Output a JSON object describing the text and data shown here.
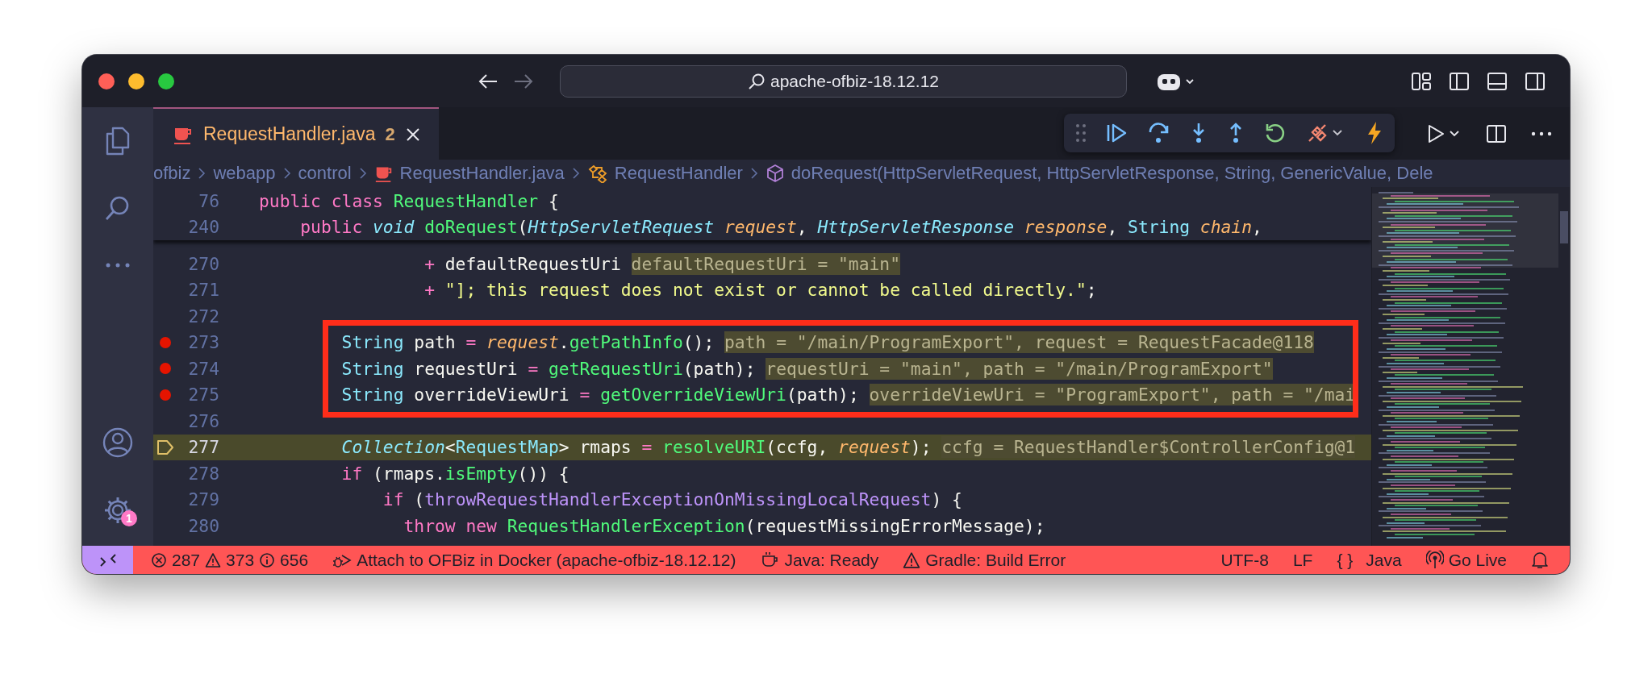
{
  "window": {
    "title": "apache-ofbiz-18.12.12"
  },
  "activity_bar": {
    "settings_badge": "1"
  },
  "tabs": [
    {
      "label": "RequestHandler.java",
      "problems": "2",
      "selected": true
    }
  ],
  "breadcrumbs": [
    {
      "kind": "folder",
      "label": "ofbiz"
    },
    {
      "kind": "folder",
      "label": "webapp"
    },
    {
      "kind": "folder",
      "label": "control"
    },
    {
      "kind": "file",
      "label": "RequestHandler.java"
    },
    {
      "kind": "class",
      "label": "RequestHandler"
    },
    {
      "kind": "method",
      "label": "doRequest(HttpServletRequest, HttpServletResponse, String, GenericValue, Dele"
    }
  ],
  "sticky_lines": [
    {
      "number": "76",
      "tokens": [
        {
          "kind": "kw",
          "text": "public class "
        },
        {
          "kind": "fn",
          "text": "RequestHandler"
        },
        {
          "kind": "plain",
          "text": " {"
        }
      ]
    },
    {
      "number": "240",
      "tokens": [
        {
          "kind": "kw",
          "text": "    public "
        },
        {
          "kind": "typei",
          "text": "void "
        },
        {
          "kind": "fn",
          "text": "doRequest"
        },
        {
          "kind": "plain",
          "text": "("
        },
        {
          "kind": "typei",
          "text": "HttpServletRequest"
        },
        {
          "kind": "param",
          "text": " request"
        },
        {
          "kind": "plain",
          "text": ", "
        },
        {
          "kind": "typei",
          "text": "HttpServletResponse"
        },
        {
          "kind": "param",
          "text": " response"
        },
        {
          "kind": "plain",
          "text": ", "
        },
        {
          "kind": "type",
          "text": "String"
        },
        {
          "kind": "param",
          "text": " chain"
        },
        {
          "kind": "plain",
          "text": ","
        }
      ]
    }
  ],
  "lines": [
    {
      "number": "270",
      "breakpoint": false,
      "current": false,
      "boxed": false,
      "tokens": [
        {
          "kind": "op",
          "text": "                + "
        },
        {
          "kind": "plain",
          "text": "defaultRequestUri "
        },
        {
          "kind": "hint",
          "text": "defaultRequestUri = \"main\""
        }
      ]
    },
    {
      "number": "271",
      "breakpoint": false,
      "current": false,
      "boxed": false,
      "tokens": [
        {
          "kind": "op",
          "text": "                + "
        },
        {
          "kind": "str",
          "text": "\"]; this request does not exist or cannot be called directly.\""
        },
        {
          "kind": "plain",
          "text": ";"
        }
      ]
    },
    {
      "number": "272",
      "breakpoint": false,
      "current": false,
      "boxed": false
    },
    {
      "number": "273",
      "breakpoint": true,
      "current": false,
      "boxed": true,
      "tokens": [
        {
          "kind": "type",
          "text": "        String"
        },
        {
          "kind": "plain",
          "text": " path "
        },
        {
          "kind": "op",
          "text": "="
        },
        {
          "kind": "param",
          "text": " request"
        },
        {
          "kind": "plain",
          "text": "."
        },
        {
          "kind": "fn",
          "text": "getPathInfo"
        },
        {
          "kind": "plain",
          "text": "(); "
        },
        {
          "kind": "hint",
          "text": "path = \"/main/ProgramExport\", request = RequestFacade@118"
        }
      ]
    },
    {
      "number": "274",
      "breakpoint": true,
      "current": false,
      "boxed": true,
      "tokens": [
        {
          "kind": "type",
          "text": "        String"
        },
        {
          "kind": "plain",
          "text": " requestUri "
        },
        {
          "kind": "op",
          "text": "="
        },
        {
          "kind": "fn",
          "text": " getRequestUri"
        },
        {
          "kind": "plain",
          "text": "(path); "
        },
        {
          "kind": "hint",
          "text": "requestUri = \"main\", path = \"/main/ProgramExport\""
        }
      ]
    },
    {
      "number": "275",
      "breakpoint": true,
      "current": false,
      "boxed": true,
      "tokens": [
        {
          "kind": "type",
          "text": "        String"
        },
        {
          "kind": "plain",
          "text": " overrideViewUri "
        },
        {
          "kind": "op",
          "text": "="
        },
        {
          "kind": "fn",
          "text": " getOverrideViewUri"
        },
        {
          "kind": "plain",
          "text": "(path); "
        },
        {
          "kind": "hint",
          "text": "overrideViewUri = \"ProgramExport\", path = \"/mai"
        }
      ]
    },
    {
      "number": "276",
      "breakpoint": false,
      "current": false,
      "boxed": false
    },
    {
      "number": "277",
      "breakpoint": false,
      "current": true,
      "boxed": false,
      "tokens": [
        {
          "kind": "typei",
          "text": "        Collection"
        },
        {
          "kind": "plain",
          "text": "<"
        },
        {
          "kind": "type",
          "text": "RequestMap"
        },
        {
          "kind": "plain",
          "text": "> rmaps "
        },
        {
          "kind": "op",
          "text": "="
        },
        {
          "kind": "fn",
          "text": " resolveURI"
        },
        {
          "kind": "plain",
          "text": "(ccfg, "
        },
        {
          "kind": "param",
          "text": "request"
        },
        {
          "kind": "plain",
          "text": "); "
        },
        {
          "kind": "hint",
          "text": "ccfg = RequestHandler$ControllerConfig@1"
        }
      ]
    },
    {
      "number": "278",
      "breakpoint": false,
      "current": false,
      "boxed": false,
      "tokens": [
        {
          "kind": "kw",
          "text": "        if"
        },
        {
          "kind": "plain",
          "text": " (rmaps."
        },
        {
          "kind": "fn",
          "text": "isEmpty"
        },
        {
          "kind": "plain",
          "text": "()) {"
        }
      ]
    },
    {
      "number": "279",
      "breakpoint": false,
      "current": false,
      "boxed": false,
      "tokens": [
        {
          "kind": "kw",
          "text": "            if"
        },
        {
          "kind": "plain",
          "text": " ("
        },
        {
          "kind": "field",
          "text": "throwRequestHandlerExceptionOnMissingLocalRequest"
        },
        {
          "kind": "plain",
          "text": ") {"
        }
      ]
    },
    {
      "number": "280",
      "breakpoint": false,
      "current": false,
      "boxed": false,
      "tokens": [
        {
          "kind": "kw",
          "text": "              throw new"
        },
        {
          "kind": "fn",
          "text": " RequestHandlerException"
        },
        {
          "kind": "plain",
          "text": "(requestMissingErrorMessage);"
        }
      ]
    }
  ],
  "status_bar": {
    "problems": {
      "errors": "287",
      "warnings": "373",
      "infos": "656"
    },
    "left_items": [
      {
        "kind": "debug",
        "label": "Attach to OFBiz in Docker (apache-ofbiz-18.12.12)"
      },
      {
        "kind": "java",
        "label": "Java: Ready"
      },
      {
        "kind": "warning",
        "label": "Gradle: Build Error"
      }
    ],
    "right_items": [
      {
        "kind": "plain",
        "label": "UTF-8"
      },
      {
        "kind": "plain",
        "label": "LF"
      },
      {
        "kind": "language",
        "icon_text": "{ }",
        "label": "Java"
      },
      {
        "kind": "broadcast",
        "label": "Go Live"
      }
    ]
  }
}
